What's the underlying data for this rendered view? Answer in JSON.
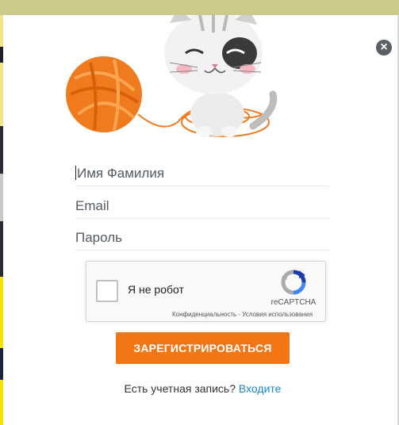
{
  "form": {
    "name_placeholder": "Имя Фамилия",
    "email_placeholder": "Email",
    "password_placeholder": "Пароль"
  },
  "captcha": {
    "label": "Я не робот",
    "brand": "reCAPTCHA",
    "links": "Конфиденциальность - Условия использования"
  },
  "register_button": "ЗАРЕГИСТРИРОВАТЬСЯ",
  "login": {
    "prompt": "Есть учетная запись?",
    "link": "Входите"
  },
  "icons": {
    "close": "close-icon",
    "illustration": "cat-with-yarn-illustration",
    "recaptcha": "recaptcha-logo-icon"
  },
  "colors": {
    "accent": "#f27614",
    "link": "#1a8ac6",
    "close_bg": "#5a5f66"
  }
}
